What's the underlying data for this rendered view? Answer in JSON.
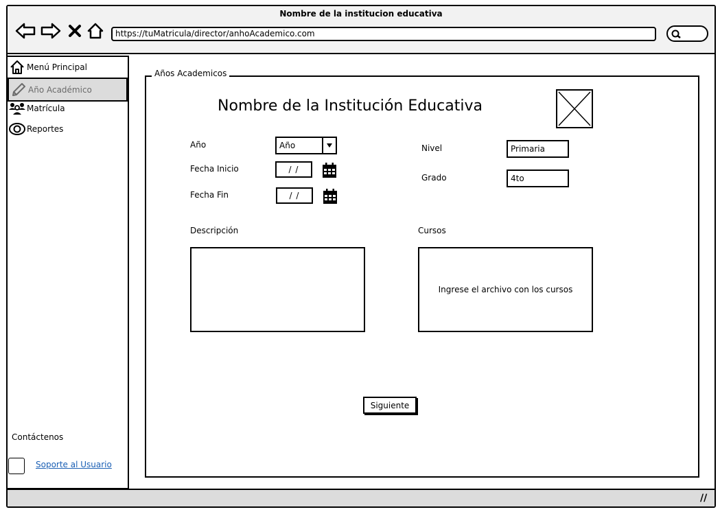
{
  "window": {
    "title": "Nombre de la institucion educativa"
  },
  "browser": {
    "url": "https://tuMatricula/director/anhoAcademico.com",
    "nav_icons": [
      "back-arrow-icon",
      "forward-arrow-icon",
      "close-x-icon",
      "home-icon"
    ],
    "search_icon": "search-icon"
  },
  "sidebar": {
    "items": [
      {
        "label": "Menú Principal",
        "icon": "home-icon",
        "active": false
      },
      {
        "label": "Año Académico",
        "icon": "pencil-icon",
        "active": true
      },
      {
        "label": "Matrícula",
        "icon": "users-icon",
        "active": false
      },
      {
        "label": "Reportes",
        "icon": "eye-icon",
        "active": false
      }
    ],
    "contact_label": "Contáctenos",
    "support_link": "Soporte al Usuario"
  },
  "main": {
    "legend": "Años Academicos",
    "heading": "Nombre de la Institución Educativa",
    "image_placeholder": "image-placeholder-icon",
    "fields": {
      "anio_label": "Año",
      "anio_value": "Año",
      "fecha_inicio_label": "Fecha Inicio",
      "fecha_inicio_value": "/ /",
      "fecha_fin_label": "Fecha Fin",
      "fecha_fin_value": "/ /",
      "nivel_label": "Nivel",
      "nivel_value": "Primaria",
      "grado_label": "Grado",
      "grado_value": "4to"
    },
    "descripcion_label": "Descripción",
    "cursos_label": "Cursos",
    "cursos_placeholder": "Ingrese el archivo con los cursos",
    "next_button": "Siguiente"
  },
  "colors": {
    "active_item_bg": "#dcdcdc",
    "link": "#1a5fb4",
    "statusbar": "#dcdcdc"
  }
}
